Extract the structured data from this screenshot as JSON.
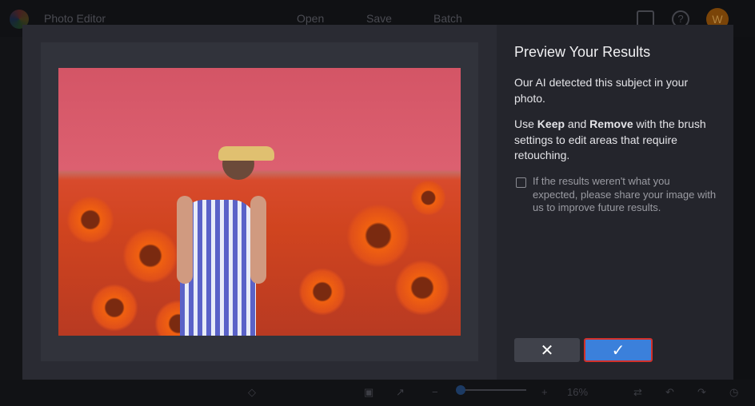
{
  "topbar": {
    "app_title": "Photo Editor",
    "menu": [
      "Open",
      "Save",
      "Batch"
    ],
    "avatar_initial": "W"
  },
  "bottombar": {
    "zoom_level": "16%"
  },
  "modal": {
    "title": "Preview Your Results",
    "description": "Our AI detected this subject in your photo.",
    "instruction_pre": "Use ",
    "keep": "Keep",
    "instruction_mid": " and ",
    "remove": "Remove",
    "instruction_post": " with the brush settings to edit areas that require retouching.",
    "feedback_label": "If the results weren't what you expected, please share your image with us to improve future results.",
    "feedback_checked": false,
    "accent": "#3b80db"
  }
}
